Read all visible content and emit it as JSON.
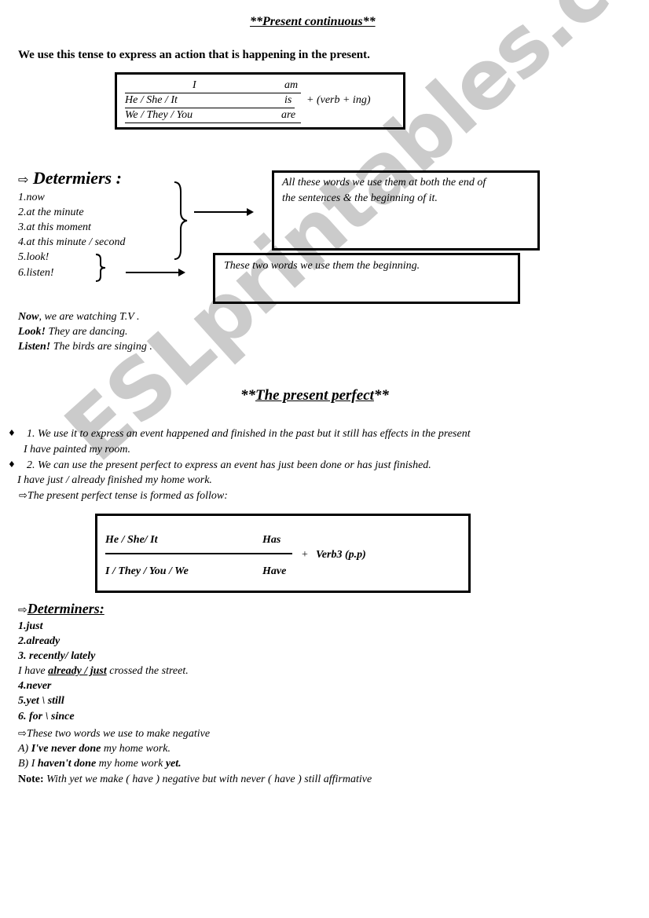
{
  "watermark": "ESLprintables.com",
  "section1": {
    "title": "**Present continuous**",
    "intro": "We use this tense to express an action that is happening in the present.",
    "table": {
      "rows": [
        {
          "subject": "I",
          "verb": "am"
        },
        {
          "subject": "He / She / It",
          "verb": "is"
        },
        {
          "subject": "We / They / You",
          "verb": "are"
        }
      ],
      "suffix": "+ (verb + ing)"
    },
    "determiners_heading": "Determiers :",
    "determiners": [
      "1.now",
      "2.at the minute",
      "3.at this moment",
      "4.at this minute / second",
      "5.look!",
      "6.listen!"
    ],
    "note_box_1": "All these words we use them at both the end of the sentences & the beginning of it.",
    "note_box_1_line1": "All these words we use them at both the end of",
    "note_box_1_line2": "the sentences & the beginning of it.",
    "note_box_2": "These two words we use them the beginning.",
    "examples": [
      {
        "bold": "Now",
        "rest": ", we are watching T.V ."
      },
      {
        "bold": "Look!",
        "rest": " They are dancing."
      },
      {
        "bold": "Listen!",
        "rest": " The birds are singing ."
      }
    ]
  },
  "section2": {
    "title_prefix": "**",
    "title_main": "The present perfect",
    "title_suffix": "**",
    "bullets": [
      {
        "marker": "♦",
        "text": "1. We use it to express an event happened and finished in the past but it still has effects in the present",
        "example": "I have painted my room."
      },
      {
        "marker": "♦",
        "text": "2. We can use the present perfect to express an event has just been done or has just finished.",
        "example": "I have just / already finished my home work."
      }
    ],
    "formed_as": "The present perfect tense is formed as follow:",
    "table": {
      "row1_subject": "He / She/ It",
      "row1_verb": "Has",
      "row2_subject": "I / They / You / We",
      "row2_verb": "Have",
      "suffix_plus": "+",
      "suffix": "Verb3  (p.p)"
    },
    "determiners_heading": "Determiners:",
    "determiners_a": [
      "1.just",
      "2.already",
      "3. recently/ lately"
    ],
    "example_pre": "I have ",
    "example_bold": "already / just",
    "example_post": " crossed the street.",
    "determiners_b": [
      "4.never",
      "5.yet  \\  still",
      "6. for \\ since"
    ],
    "negative_note": "These two words we use to make negative",
    "example_a_prefix": "A) ",
    "example_a_bold": "I've never done",
    "example_a_rest": " my home work.",
    "example_b_prefix": "B) I ",
    "example_b_bold": "haven't done",
    "example_b_rest": " my home work ",
    "example_b_end": "yet.",
    "note_label": "Note:",
    "note_text": " With yet we make ( have ) negative but with never ( have ) still affirmative"
  },
  "icons": {
    "arrow_right": "⇨"
  }
}
